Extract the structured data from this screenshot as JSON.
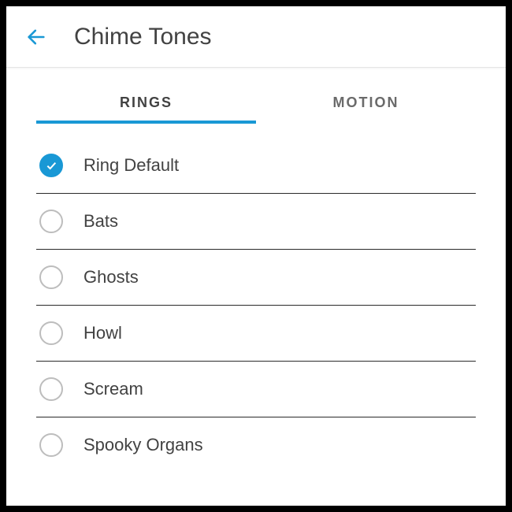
{
  "header": {
    "title": "Chime Tones"
  },
  "tabs": {
    "rings": "RINGS",
    "motion": "MOTION",
    "active": "rings"
  },
  "tones": [
    {
      "label": "Ring Default",
      "selected": true
    },
    {
      "label": "Bats",
      "selected": false
    },
    {
      "label": "Ghosts",
      "selected": false
    },
    {
      "label": "Howl",
      "selected": false
    },
    {
      "label": "Scream",
      "selected": false
    },
    {
      "label": "Spooky Organs",
      "selected": false
    }
  ],
  "colors": {
    "accent": "#1998d5"
  }
}
